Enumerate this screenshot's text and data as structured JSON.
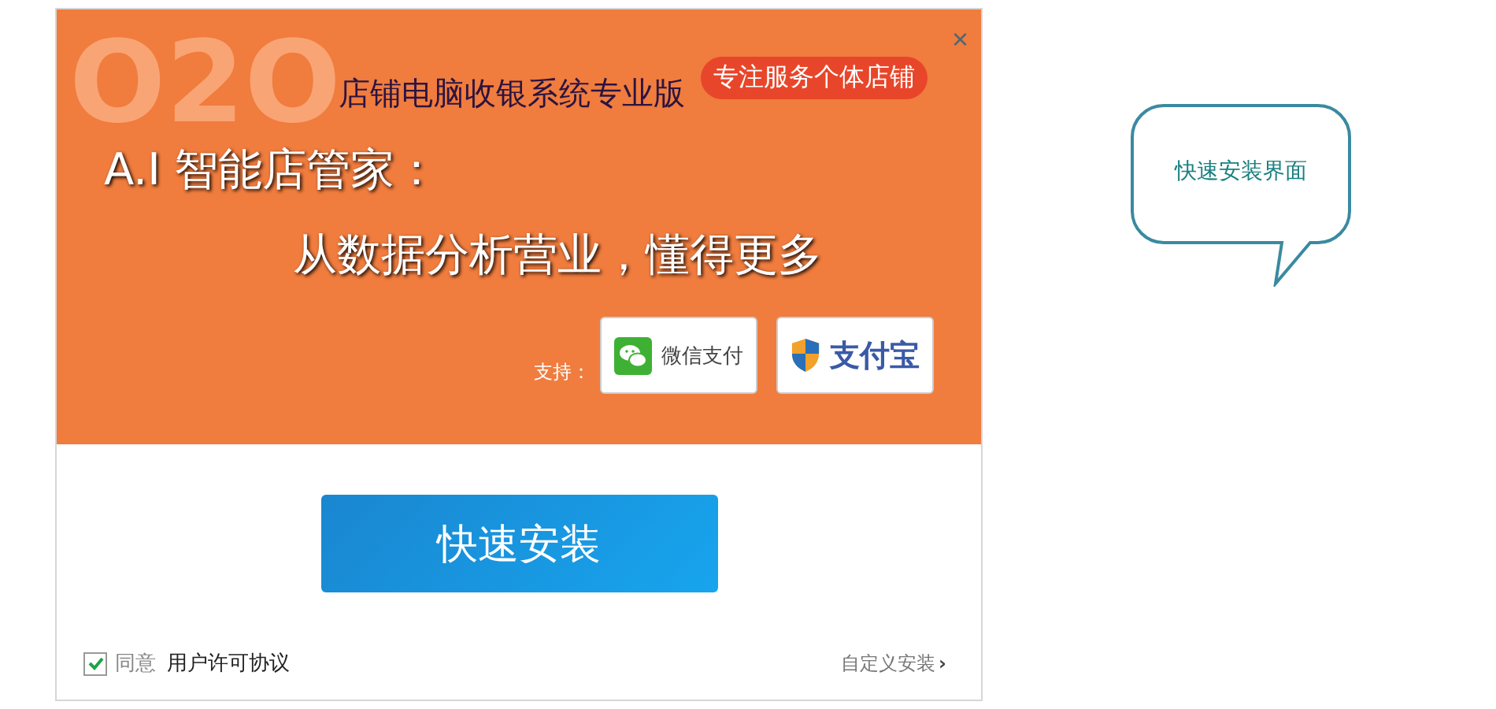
{
  "banner": {
    "watermark": "O2O",
    "title": "店铺电脑收银系统专业版",
    "badge": "专注服务个体店铺",
    "close": "×",
    "headline": "A.I 智能店管家：",
    "tagline": "从数据分析营业，懂得更多",
    "support_label": "支持：",
    "payments": [
      {
        "kind": "wechat",
        "label": "微信支付"
      },
      {
        "kind": "alipay",
        "label": "支付宝"
      }
    ]
  },
  "install_button": "快速安装",
  "agreement": {
    "checked": true,
    "label": "同意",
    "link": "用户许可协议"
  },
  "custom_install": {
    "label": "自定义安装",
    "arrow": "›"
  },
  "callout": "快速安装界面"
}
